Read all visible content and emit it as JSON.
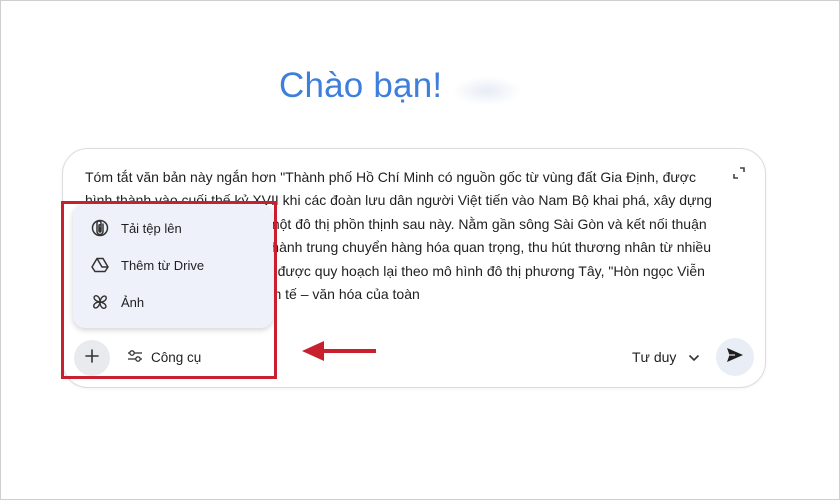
{
  "greeting": "Chào bạn!",
  "prompt_text": "Tóm tắt văn bản này ngắn hơn \"Thành phố Hồ Chí Minh có nguồn gốc từ vùng đất Gia Định, được hình thành vào cuối thế kỷ XVII khi các đoàn lưu dân người Việt tiến vào Nam Bộ khai phá, xây dựng những nền tảng đầu tiên cho một đô thị phồn thịnh sau này. Nằm gần sông Sài Gòn và kết nối thuận lợi với biển, vùng đất này trở thành trung chuyển hàng hóa quan trọng, thu hút thương nhân từ nhiều nơi. Thế kỷ thuộc địa, Sài Gòn được quy hoạch lại theo mô hình đô thị phương Tây, \"Hòn ngọc Viễn Đông\" với vai trò trung tâm kinh tế – văn hóa của toàn",
  "menu": {
    "upload_label": "Tải tệp lên",
    "drive_label": "Thêm từ Drive",
    "photo_label": "Ảnh"
  },
  "toolbar": {
    "tools_label": "Công cụ",
    "mode_label": "Tư duy"
  },
  "colors": {
    "greeting": "#3f7fdc",
    "annotation": "#c8202f",
    "menu_bg": "#eef1fa"
  },
  "icons": {
    "upload": "paperclip-icon",
    "drive": "google-drive-icon",
    "photo": "pinwheel-icon",
    "info": "info-icon",
    "plus": "plus-icon",
    "tools": "sliders-icon",
    "mode": "chevron-down-icon",
    "send": "send-icon",
    "expand": "expand-icon"
  }
}
